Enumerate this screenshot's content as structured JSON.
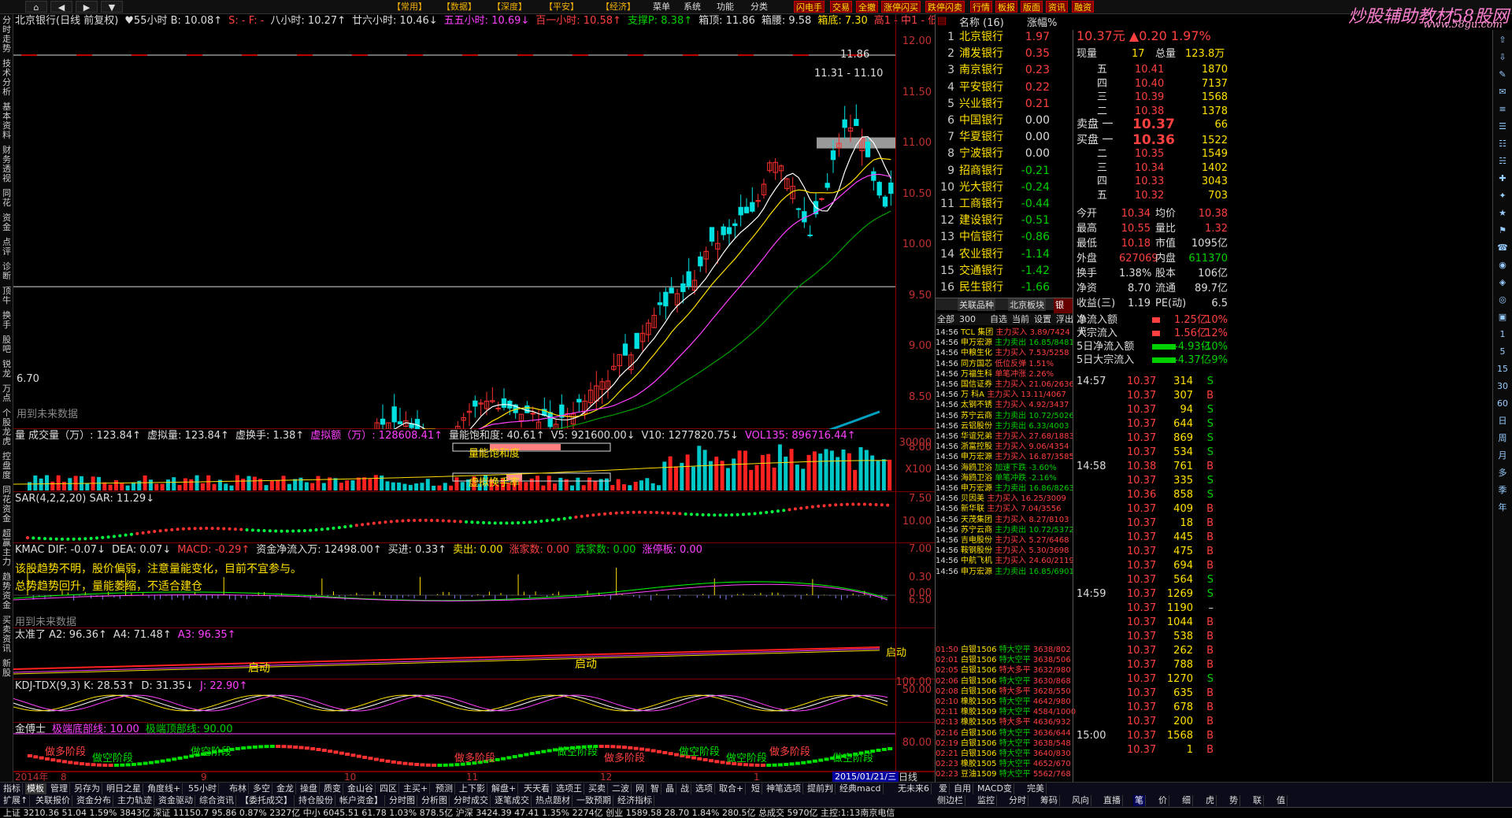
{
  "menu": {
    "nav": [
      "⌂",
      "◀",
      "▶",
      "▼"
    ],
    "items": [
      "【常用】",
      "【数据】",
      "【深度】",
      "【平安】",
      "【经济】",
      "菜单",
      "系统",
      "功能",
      "分类"
    ],
    "quick": [
      "闪电手",
      "交易",
      "全撤",
      "涨停闪买",
      "跌停闪卖",
      "行情",
      "板报",
      "版面",
      "资讯",
      "融资"
    ]
  },
  "logo": {
    "text": "炒股辅助教材58股网",
    "url": "www.58gu.com"
  },
  "left_tabs": [
    "分时走势",
    "技术分析",
    "基本资料",
    "财务透视",
    "同花",
    "资金",
    "点评",
    "诊断",
    "顶牛",
    "换手",
    "股吧",
    "锐龙",
    "万点",
    "个股龙虎",
    "控盘度",
    "同花资金",
    "超赢主力",
    "趋势资金",
    "买卖资讯",
    "新股"
  ],
  "main_panel": {
    "title_parts": [
      {
        "t": "北京银行(日线 前复权)",
        "c": "white"
      },
      {
        "t": "♥55小时 B: 10.08↑",
        "c": "white"
      },
      {
        "t": "S: - F: -",
        "c": "red"
      },
      {
        "t": "八小时: 10.27↑",
        "c": "white"
      },
      {
        "t": "廿六小时: 10.46↓",
        "c": "white"
      },
      {
        "t": "五五小时: 10.69↓",
        "c": "mag"
      },
      {
        "t": "百一小时: 10.58↑",
        "c": "red"
      },
      {
        "t": "支撑P: 8.38↑",
        "c": "green"
      },
      {
        "t": "箱顶: 11.86",
        "c": "white"
      },
      {
        "t": "箱腰: 9.58",
        "c": "white"
      },
      {
        "t": "箱底: 7.30",
        "c": "yellow"
      },
      {
        "t": "高1 - 中1 - 低1 -",
        "c": "red"
      }
    ],
    "y_labels": [
      "12.00",
      "11.50",
      "11.00",
      "10.50",
      "10.00",
      "9.50",
      "9.00",
      "8.50",
      "8.00",
      "7.50",
      "7.00",
      "6.50"
    ],
    "annotations": {
      "top": "11.86",
      "range": "11.31 - 11.10",
      "low": "6.70",
      "future": "用到未来数据"
    }
  },
  "vol_panel": {
    "title_parts": [
      {
        "t": "量 成交量（万）: 123.84↑",
        "c": "white"
      },
      {
        "t": "虚拟量: 123.84↑",
        "c": "white"
      },
      {
        "t": "虚换手: 1.38↑",
        "c": "white"
      },
      {
        "t": "虚拟额（万）: 128608.41↑",
        "c": "mag"
      },
      {
        "t": "量能饱和度: 40.61↑",
        "c": "white"
      },
      {
        "t": "V5: 921600.00↓",
        "c": "white"
      },
      {
        "t": "V10: 1277820.75↓",
        "c": "white"
      },
      {
        "t": "VOL135: 896716.44↑",
        "c": "mag"
      }
    ],
    "box_labels": [
      "量能饱和度",
      "虚拟换手率"
    ],
    "y_labels": [
      "30000",
      "X100"
    ]
  },
  "sar_panel": {
    "title_parts": [
      {
        "t": "SAR(4,2,2,20) SAR: 11.29↓",
        "c": "white"
      }
    ],
    "y_labels": [
      "10.00"
    ]
  },
  "macd_panel": {
    "title_parts": [
      {
        "t": "KMAC DIF: -0.07↓",
        "c": "white"
      },
      {
        "t": "DEA: 0.07↓",
        "c": "white"
      },
      {
        "t": "MACD: -0.29↑",
        "c": "red"
      },
      {
        "t": "资金净流入万: 12498.00↑",
        "c": "white"
      },
      {
        "t": "买进: 0.33↑",
        "c": "white"
      },
      {
        "t": "卖出: 0.00",
        "c": "yellow"
      },
      {
        "t": "涨家数: 0.00",
        "c": "red"
      },
      {
        "t": "跌家数: 0.00",
        "c": "green"
      },
      {
        "t": "涨停板: 0.00",
        "c": "mag"
      }
    ],
    "line2": "该股趋势不明，股价偏弱，注意量能变化，目前不宜参与。",
    "line3": "总势趋势回升，量能萎缩，不适合建仓",
    "future": "用到未来数据",
    "y_labels": [
      "0.30",
      "0.00"
    ]
  },
  "qi_panel": {
    "title_parts": [
      {
        "t": "太准了 A2: 96.36↑",
        "c": "white"
      },
      {
        "t": "A4: 71.48↑",
        "c": "white"
      },
      {
        "t": "A3: 96.35↑",
        "c": "mag"
      }
    ],
    "labels": [
      "启动",
      "启动",
      "启动"
    ]
  },
  "kdj_panel": {
    "title_parts": [
      {
        "t": "KDJ-TDX(9,3) K: 28.53↑",
        "c": "white"
      },
      {
        "t": "D: 31.35↓",
        "c": "white"
      },
      {
        "t": "J: 22.90↑",
        "c": "mag"
      }
    ],
    "y_labels": [
      "100.00",
      "50.00"
    ]
  },
  "jin_panel": {
    "title_parts": [
      {
        "t": "金傅士",
        "c": "white"
      },
      {
        "t": "极端底部线: 10.00",
        "c": "mag"
      },
      {
        "t": "极端顶部线: 90.00",
        "c": "green"
      }
    ],
    "stage_labels": [
      "做多阶段",
      "做空阶段",
      "做空阶段",
      "做多阶段",
      "做空阶段",
      "做多阶段",
      "做空阶段",
      "做空阶段",
      "做多阶段",
      "做空阶段"
    ],
    "y_labels": [
      "80.00"
    ]
  },
  "x_axis": {
    "labels": [
      "2014年",
      "8",
      "9",
      "10",
      "11",
      "12",
      "1"
    ],
    "date": "2015/01/21/三",
    "period": "日线"
  },
  "stock_list": {
    "headers": [
      "名称 (16)",
      "涨幅%"
    ],
    "rows": [
      {
        "no": "1",
        "name": "北京银行",
        "pct": "1.97",
        "c": "red"
      },
      {
        "no": "2",
        "name": "浦发银行",
        "pct": "0.35",
        "c": "red"
      },
      {
        "no": "3",
        "name": "南京银行",
        "pct": "0.23",
        "c": "red"
      },
      {
        "no": "4",
        "name": "平安银行",
        "pct": "0.22",
        "c": "red"
      },
      {
        "no": "5",
        "name": "兴业银行",
        "pct": "0.21",
        "c": "red"
      },
      {
        "no": "6",
        "name": "中国银行",
        "pct": "0.00",
        "c": "white"
      },
      {
        "no": "7",
        "name": "华夏银行",
        "pct": "0.00",
        "c": "white"
      },
      {
        "no": "8",
        "name": "宁波银行",
        "pct": "0.00",
        "c": "white"
      },
      {
        "no": "9",
        "name": "招商银行",
        "pct": "-0.21",
        "c": "green"
      },
      {
        "no": "10",
        "name": "光大银行",
        "pct": "-0.24",
        "c": "green"
      },
      {
        "no": "11",
        "name": "工商银行",
        "pct": "-0.44",
        "c": "green"
      },
      {
        "no": "12",
        "name": "建设银行",
        "pct": "-0.51",
        "c": "green"
      },
      {
        "no": "13",
        "name": "中信银行",
        "pct": "-0.86",
        "c": "green"
      },
      {
        "no": "14",
        "name": "农业银行",
        "pct": "-1.14",
        "c": "green"
      },
      {
        "no": "15",
        "name": "交通银行",
        "pct": "-1.42",
        "c": "green"
      },
      {
        "no": "16",
        "name": "民生银行",
        "pct": "-1.66",
        "c": "green"
      }
    ],
    "tabs": [
      "关联品种",
      "北京板块",
      "银行"
    ]
  },
  "ticker": {
    "tabs": [
      "全部",
      "300",
      "自选",
      "当前",
      "设置",
      "浮出",
      "总览"
    ],
    "rows": [
      {
        "t": "14:56",
        "n": "TCL 集团",
        "type": "主力买入",
        "v": "3.89/7424"
      },
      {
        "t": "14:56",
        "n": "申万宏源",
        "type": "主力卖出",
        "v": "16.85/8481"
      },
      {
        "t": "14:56",
        "n": "中粮生化",
        "type": "主力买入",
        "v": "7.53/5258"
      },
      {
        "t": "14:56",
        "n": "同方国芯",
        "type": "低位反弹",
        "v": "1.51%"
      },
      {
        "t": "14:56",
        "n": "万福生科",
        "type": "单笔冲涨",
        "v": "2.26%"
      },
      {
        "t": "14:56",
        "n": "国信证券",
        "type": "主力买入",
        "v": "21.06/2636"
      },
      {
        "t": "14:56",
        "n": "万 科A",
        "type": "主力买入",
        "v": "13.11/4067"
      },
      {
        "t": "14:56",
        "n": "太钢不锈",
        "type": "主力买入",
        "v": "4.92/3437"
      },
      {
        "t": "14:56",
        "n": "苏宁云商",
        "type": "主力卖出",
        "v": "10.72/5026"
      },
      {
        "t": "14:56",
        "n": "云铝股份",
        "type": "主力卖出",
        "v": "6.33/4003"
      },
      {
        "t": "14:56",
        "n": "华谊兄弟",
        "type": "主力买入",
        "v": "27.68/1883"
      },
      {
        "t": "14:56",
        "n": "浙富控股",
        "type": "主力买入",
        "v": "9.06/4354"
      },
      {
        "t": "14:56",
        "n": "申万宏源",
        "type": "主力买入",
        "v": "16.87/3585"
      },
      {
        "t": "14:56",
        "n": "海鸥卫浴",
        "type": "加速下跌",
        "v": "-3.60%"
      },
      {
        "t": "14:56",
        "n": "海鸥卫浴",
        "type": "单笔冲跌",
        "v": "-2.16%"
      },
      {
        "t": "14:56",
        "n": "申万宏源",
        "type": "主力卖出",
        "v": "16.86/8263"
      },
      {
        "t": "14:56",
        "n": "贝因美",
        "type": "主力买入",
        "v": "16.25/3009"
      },
      {
        "t": "14:56",
        "n": "新华联",
        "type": "主力买入",
        "v": "7.04/3556"
      },
      {
        "t": "14:56",
        "n": "天茂集团",
        "type": "主力买入",
        "v": "8.27/8103"
      },
      {
        "t": "14:56",
        "n": "苏宁云商",
        "type": "主力卖出",
        "v": "10.72/5372"
      },
      {
        "t": "14:56",
        "n": "吉电股份",
        "type": "主力买入",
        "v": "5.27/6468"
      },
      {
        "t": "14:56",
        "n": "鞍钢股份",
        "type": "主力买入",
        "v": "5.30/3698"
      },
      {
        "t": "14:56",
        "n": "中航飞机",
        "type": "主力买入",
        "v": "24.60/2119"
      },
      {
        "t": "14:56",
        "n": "申万宏源",
        "type": "主力卖出",
        "v": "16.85/6901"
      }
    ],
    "rows2": [
      {
        "t": "01:50",
        "n": "白银1506",
        "type": "特大空平",
        "v": "3638/802"
      },
      {
        "t": "02:01",
        "n": "白银1506",
        "type": "特大空平",
        "v": "3638/506"
      },
      {
        "t": "02:05",
        "n": "白银1506",
        "type": "特大多平",
        "v": "3632/980"
      },
      {
        "t": "02:06",
        "n": "白银1506",
        "type": "特大空平",
        "v": "3630/868"
      },
      {
        "t": "02:08",
        "n": "白银1506",
        "type": "特大多平",
        "v": "3628/550"
      },
      {
        "t": "02:10",
        "n": "橡胶1505",
        "type": "特大空平",
        "v": "4642/980"
      },
      {
        "t": "02:11",
        "n": "橡胶1509",
        "type": "特大空平",
        "v": "4584/1000"
      },
      {
        "t": "02:13",
        "n": "橡胶1505",
        "type": "特大多平",
        "v": "4636/932"
      },
      {
        "t": "02:16",
        "n": "白银1506",
        "type": "特大空平",
        "v": "3636/644"
      },
      {
        "t": "02:19",
        "n": "白银1506",
        "type": "特大空平",
        "v": "3638/548"
      },
      {
        "t": "02:21",
        "n": "白银1506",
        "type": "特大空平",
        "v": "3640/830"
      },
      {
        "t": "02:23",
        "n": "橡胶1505",
        "type": "特大空平",
        "v": "4652/670"
      },
      {
        "t": "02:23",
        "n": "豆油1509",
        "type": "特大空平",
        "v": "5562/768"
      }
    ]
  },
  "quote": {
    "price_big": "10.37元 ▲0.20  1.97%",
    "now_label": "现量",
    "now": "17",
    "total_label": "总量",
    "total": "123.8万",
    "asks": [
      {
        "lbl": "五",
        "p": "10.41",
        "v": "1870"
      },
      {
        "lbl": "四",
        "p": "10.40",
        "v": "7137"
      },
      {
        "lbl": "三",
        "p": "10.39",
        "v": "1568"
      },
      {
        "lbl": "二",
        "p": "10.38",
        "v": "1378"
      },
      {
        "lbl": "卖盘 一",
        "p": "10.37",
        "v": "66"
      }
    ],
    "bids": [
      {
        "lbl": "买盘 一",
        "p": "10.36",
        "v": "1522"
      },
      {
        "lbl": "二",
        "p": "10.35",
        "v": "1549"
      },
      {
        "lbl": "三",
        "p": "10.34",
        "v": "1402"
      },
      {
        "lbl": "四",
        "p": "10.33",
        "v": "3043"
      },
      {
        "lbl": "五",
        "p": "10.32",
        "v": "703"
      }
    ],
    "stats": [
      {
        "a": "今开",
        "av": "10.34",
        "ac": "red",
        "b": "均价",
        "bv": "10.38",
        "bc": "red"
      },
      {
        "a": "最高",
        "av": "10.55",
        "ac": "red",
        "b": "量比",
        "bv": "1.32",
        "bc": "red"
      },
      {
        "a": "最低",
        "av": "10.18",
        "ac": "red",
        "b": "市值",
        "bv": "1095亿",
        "bc": "white"
      },
      {
        "a": "外盘",
        "av": "627069",
        "ac": "red",
        "b": "内盘",
        "bv": "611370",
        "bc": "green"
      },
      {
        "a": "换手",
        "av": "1.38%",
        "ac": "white",
        "b": "股本",
        "bv": "106亿",
        "bc": "white"
      },
      {
        "a": "净资",
        "av": "8.70",
        "ac": "white",
        "b": "流通",
        "bv": "89.7亿",
        "bc": "white"
      },
      {
        "a": "收益(三)",
        "av": "1.19",
        "ac": "white",
        "b": "PE(动)",
        "bv": "6.5",
        "bc": "white"
      }
    ],
    "flows": [
      {
        "l": "净流入额",
        "v": "1.25亿",
        "p": "10%",
        "c": "red"
      },
      {
        "l": "大宗流入",
        "v": "1.56亿",
        "p": "12%",
        "c": "red"
      },
      {
        "l": "5日净流入额",
        "v": "-4.93亿",
        "p": "-10%",
        "c": "green"
      },
      {
        "l": "5日大宗流入",
        "v": "-4.37亿",
        "p": "-9%",
        "c": "green"
      }
    ],
    "ticks": [
      {
        "t": "14:57",
        "p": "10.37",
        "v": "314",
        "s": "S"
      },
      {
        "t": "",
        "p": "10.37",
        "v": "307",
        "s": "B"
      },
      {
        "t": "",
        "p": "10.37",
        "v": "94",
        "s": "S"
      },
      {
        "t": "",
        "p": "10.37",
        "v": "644",
        "s": "S"
      },
      {
        "t": "",
        "p": "10.37",
        "v": "869",
        "s": "S"
      },
      {
        "t": "",
        "p": "10.37",
        "v": "534",
        "s": "S"
      },
      {
        "t": "14:58",
        "p": "10.38",
        "v": "761",
        "s": "B"
      },
      {
        "t": "",
        "p": "10.37",
        "v": "335",
        "s": "S"
      },
      {
        "t": "",
        "p": "10.36",
        "v": "858",
        "s": "S"
      },
      {
        "t": "",
        "p": "10.37",
        "v": "409",
        "s": "B"
      },
      {
        "t": "",
        "p": "10.37",
        "v": "18",
        "s": "B"
      },
      {
        "t": "",
        "p": "10.37",
        "v": "445",
        "s": "B"
      },
      {
        "t": "",
        "p": "10.37",
        "v": "475",
        "s": "B"
      },
      {
        "t": "",
        "p": "10.37",
        "v": "694",
        "s": "B"
      },
      {
        "t": "",
        "p": "10.37",
        "v": "564",
        "s": "S"
      },
      {
        "t": "14:59",
        "p": "10.37",
        "v": "1269",
        "s": "S"
      },
      {
        "t": "",
        "p": "10.37",
        "v": "1190",
        "s": "–"
      },
      {
        "t": "",
        "p": "10.37",
        "v": "1044",
        "s": "B"
      },
      {
        "t": "",
        "p": "10.37",
        "v": "538",
        "s": "B"
      },
      {
        "t": "",
        "p": "10.37",
        "v": "262",
        "s": "B"
      },
      {
        "t": "",
        "p": "10.37",
        "v": "788",
        "s": "B"
      },
      {
        "t": "",
        "p": "10.37",
        "v": "1270",
        "s": "S"
      },
      {
        "t": "",
        "p": "10.37",
        "v": "635",
        "s": "B"
      },
      {
        "t": "",
        "p": "10.37",
        "v": "678",
        "s": "B"
      },
      {
        "t": "",
        "p": "10.37",
        "v": "200",
        "s": "B"
      },
      {
        "t": "15:00",
        "p": "10.37",
        "v": "1568",
        "s": "B"
      },
      {
        "t": "",
        "p": "10.37",
        "v": "1",
        "s": "B"
      }
    ]
  },
  "bottom_tabs": [
    "指标",
    "模板",
    "管理",
    "另存为",
    "明日之星",
    "角度线+",
    "55小时",
    "布林",
    "多空",
    "金龙",
    "操盘",
    "质变",
    "金山谷",
    "四区",
    "主买+",
    "预测",
    "上下影",
    "解盘+",
    "天天看",
    "选项王",
    "买卖",
    "二波",
    "网",
    "智",
    "晶",
    "战",
    "选项",
    "取合+",
    "短",
    "神笔选项",
    "提前判",
    "经典macd",
    "无未来6",
    "爱",
    "自用",
    "MACD变",
    "完美"
  ],
  "bottom_tabs2": [
    "扩展↑",
    "关联报价",
    "资金分布",
    "主力轨迹",
    "资金驱动",
    "综合资讯",
    "【委托成交】",
    "持仓股份",
    "帐户资金】",
    "分时图",
    "分析图",
    "分时成交",
    "逐笔成交",
    "热点题材",
    "一致预期",
    "经济指标"
  ],
  "right_bottom_tabs": [
    "侧边栏",
    "监控",
    "分时",
    "筹码",
    "风向",
    "直播",
    "笔",
    "价",
    "细",
    "虎",
    "势",
    "联",
    "值"
  ],
  "status": "上证 3210.36  51.04  1.59%  3843亿  深证 11150.7  95.86  0.87%  2327亿  中小 6045.51  61.78  1.03%  878.5亿  沪深 3424.39  47.41  1.35%  2274亿  创业 1589.58  28.70  1.84%  280.5亿  总成交 5970亿  主控:1:13南京电信",
  "right_icons": [
    "⇧",
    "⇩",
    "✎",
    "✉",
    "≡",
    "☰",
    "☷",
    "☵",
    "✚",
    "✦",
    "★",
    "⚑",
    "☎",
    "◉",
    "◈",
    "◎",
    "▣",
    "1",
    "5",
    "15",
    "30",
    "60",
    "日",
    "周",
    "月",
    "多",
    "季",
    "年"
  ]
}
